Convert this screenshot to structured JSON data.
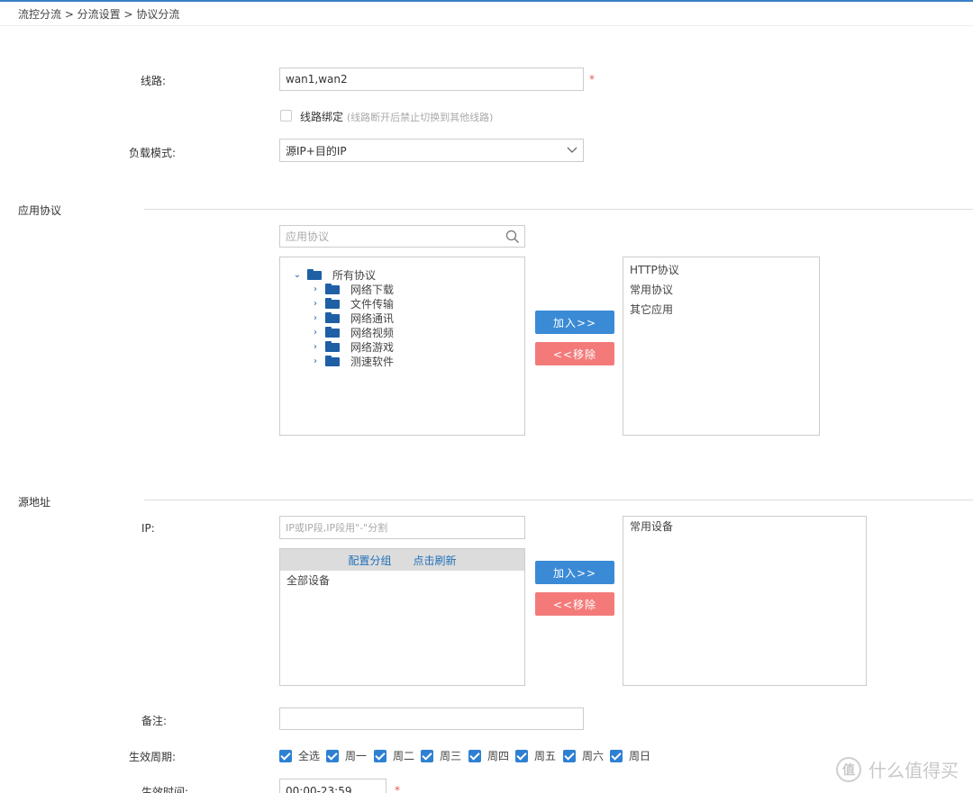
{
  "breadcrumb": "流控分流 > 分流设置 > 协议分流",
  "line": {
    "label": "线路:",
    "value": "wan1,wan2",
    "required": "*",
    "bind_label": "线路绑定",
    "bind_hint": "(线路断开后禁止切换到其他线路)"
  },
  "load_mode": {
    "label": "负载模式:",
    "value": "源IP+目的IP"
  },
  "app_protocol": {
    "section_title": "应用协议",
    "search_placeholder": "应用协议",
    "tree": {
      "root": "所有协议",
      "children": [
        "网络下载",
        "文件传输",
        "网络通讯",
        "网络视频",
        "网络游戏",
        "测速软件"
      ]
    },
    "add_button": "加入>>",
    "remove_button": "<<移除",
    "selected": [
      "HTTP协议",
      "常用协议",
      "其它应用"
    ]
  },
  "source_address": {
    "section_title": "源地址",
    "ip_label": "IP:",
    "ip_placeholder": "IP或IP段,IP段用\"-\"分割",
    "config_group": "配置分组",
    "refresh": "点击刷新",
    "devices": [
      "全部设备"
    ],
    "add_button": "加入>>",
    "remove_button": "<<移除",
    "selected": [
      "常用设备"
    ]
  },
  "remark": {
    "label": "备注:",
    "value": ""
  },
  "period": {
    "label": "生效周期:",
    "days": [
      "全选",
      "周一",
      "周二",
      "周三",
      "周四",
      "周五",
      "周六",
      "周日"
    ]
  },
  "time": {
    "label": "生效时间:",
    "value": "00:00-23:59",
    "required": "*"
  },
  "watermark": "什么值得买",
  "colors": {
    "accent": "#3a8ad6",
    "danger": "#f47a7a",
    "folder": "#1f5fa5"
  }
}
